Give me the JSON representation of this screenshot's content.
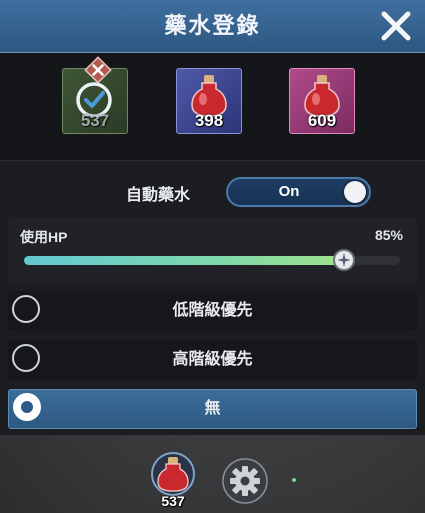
{
  "header": {
    "title": "藥水登錄",
    "close_icon": "close-icon"
  },
  "slots": [
    {
      "count": "537",
      "state": "registered",
      "icon": "check-circle-icon",
      "badge_icon": "remove-x-icon",
      "color": "#3f5735"
    },
    {
      "count": "398",
      "icon": "potion-red-icon",
      "color": "#4f5aa8"
    },
    {
      "count": "609",
      "icon": "potion-red-icon",
      "color": "#b14b8d"
    }
  ],
  "auto_potion": {
    "label": "自動藥水",
    "toggle_text": "On",
    "enabled": true
  },
  "hp": {
    "label": "使用HP",
    "value_text": "85%",
    "value": 0.85
  },
  "priority_options": [
    {
      "label": "低階級優先",
      "selected": false
    },
    {
      "label": "高階級優先",
      "selected": false
    },
    {
      "label": "無",
      "selected": true
    }
  ],
  "bottom": {
    "potion_count": "537",
    "potion_icon": "potion-red-icon",
    "settings_icon": "gear-icon"
  },
  "colors": {
    "accent": "#3f6fa0",
    "panel": "#1c1d21",
    "slider_start": "#63c8d0",
    "slider_end": "#9ee28a"
  }
}
